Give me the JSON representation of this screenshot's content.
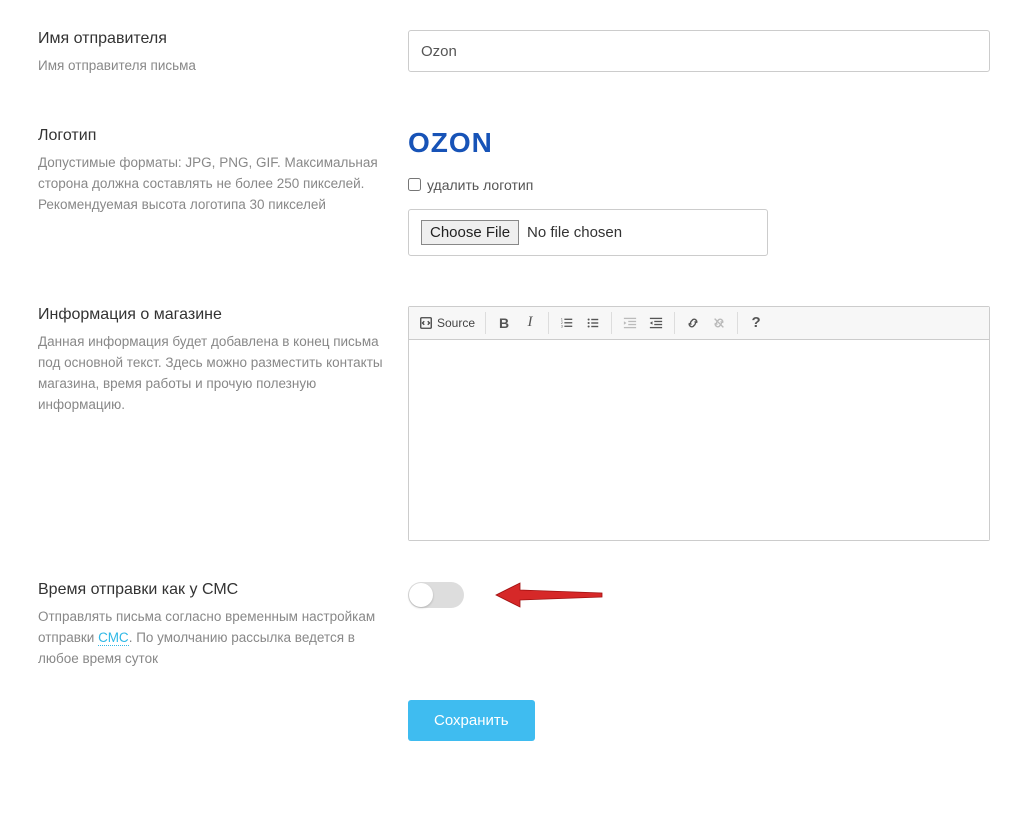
{
  "sender": {
    "title": "Имя отправителя",
    "help": "Имя отправителя письма",
    "value": "Ozon"
  },
  "logo": {
    "title": "Логотип",
    "help": "Допустимые форматы: JPG, PNG, GIF. Максимальная сторона должна составлять не более 250 пикселей. Рекомендуемая высота логотипа 30 пикселей",
    "brand_text": "OZON",
    "delete_label": "удалить логотип",
    "choose_file": "Choose File",
    "no_file": "No file chosen"
  },
  "store_info": {
    "title": "Информация о магазине",
    "help": "Данная информация будет добавлена в конец письма под основной текст. Здесь можно разместить контакты магазина, время работы и прочую полезную информацию.",
    "toolbar": {
      "source": "Source"
    }
  },
  "send_time": {
    "title": "Время отправки как у СМС",
    "help_pre": "Отправлять письма согласно временным настройкам отправки ",
    "help_link": "СМС",
    "help_post": ". По умолчанию рассылка ведется в любое время суток",
    "toggle_on": false
  },
  "submit": {
    "label": "Сохранить"
  }
}
